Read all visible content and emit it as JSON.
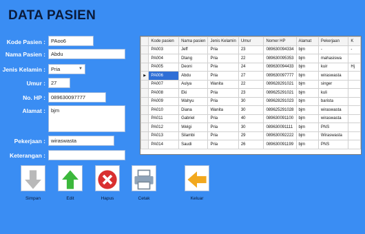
{
  "title": "DATA PASIEN",
  "form": {
    "kode_label": "Kode Pasien :",
    "kode_value": "PAoo6",
    "nama_label": "Nama Pasien :",
    "nama_value": "Abdu",
    "jk_label": "Jenis Kelamin :",
    "jk_value": "Pria",
    "umur_label": "Umur :",
    "umur_value": "27",
    "hp_label": "No. HP :",
    "hp_value": "089630097777",
    "alamat_label": "Alamat :",
    "alamat_value": "bjm",
    "pekerjaan_label": "Pekerjaan :",
    "pekerjaan_value": "wiraswasta",
    "keterangan_label": "Keterangan :",
    "keterangan_value": ""
  },
  "table": {
    "headers": [
      "Kode pasien",
      "Nama pasien",
      "Jenis Kelamin",
      "Umur",
      "Nomer HP",
      "Alamat",
      "Pekerjaan",
      "K"
    ],
    "rows": [
      [
        "PA003",
        "Jeff",
        "Pria",
        "23",
        "089630094334",
        "bjm",
        "-",
        "-"
      ],
      [
        "PA004",
        "Dtang",
        "Pria",
        "22",
        "089630095353",
        "bjm",
        "mahasiswa",
        ""
      ],
      [
        "PA005",
        "Deoni",
        "Pria",
        "24",
        "089630094433",
        "bjm",
        "kuir",
        "Hj"
      ],
      [
        "PA006",
        "Abdu",
        "Pria",
        "27",
        "089630097777",
        "bjm",
        "wiraswasta",
        ""
      ],
      [
        "PA007",
        "Aulya",
        "Wanita",
        "22",
        "089628291021",
        "bjm",
        "singer",
        ""
      ],
      [
        "PA008",
        "Eki",
        "Pria",
        "23",
        "089625291021",
        "bjm",
        "kuli",
        ""
      ],
      [
        "PA009",
        "Wahyu",
        "Pria",
        "30",
        "089628291023",
        "bjm",
        "barista",
        ""
      ],
      [
        "PA010",
        "Diana",
        "Wanita",
        "30",
        "089625291028",
        "bjm",
        "wiraswasta",
        ""
      ],
      [
        "PA011",
        "Gabriel",
        "Pria",
        "40",
        "089630091100",
        "bjm",
        "wiraswasta",
        ""
      ],
      [
        "PA012",
        "Welgi",
        "Pria",
        "30",
        "089630091111",
        "bjm",
        "PNS",
        ""
      ],
      [
        "PA013",
        "Silambi",
        "Pria",
        "29",
        "089630092222",
        "bjm",
        "Wiraswasta",
        ""
      ],
      [
        "PA014",
        "Saudi",
        "Pria",
        "26",
        "089630091199",
        "bjm",
        "PNS",
        ""
      ]
    ],
    "selected_row": 3
  },
  "buttons": {
    "simpan": "Simpan",
    "edit": "Edit",
    "hapus": "Hapus",
    "cetak": "Cetak",
    "keluar": "Keluar"
  },
  "colors": {
    "background": "#3a8df3",
    "title": "#0a1a3a",
    "selection": "#2f6fd6"
  }
}
